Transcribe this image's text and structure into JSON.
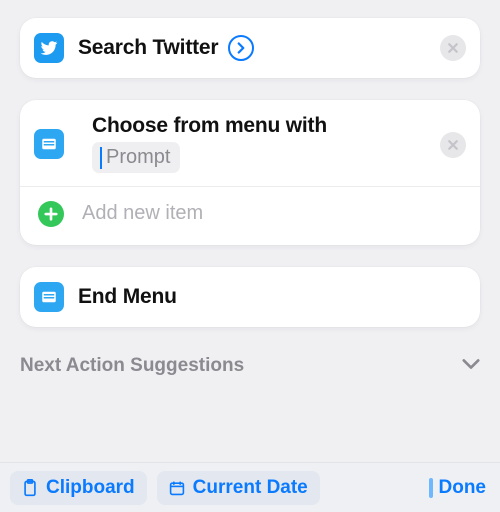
{
  "actions": {
    "search_twitter": {
      "title": "Search Twitter"
    },
    "choose_menu": {
      "title": "Choose from menu with",
      "prompt_token": "Prompt",
      "add_item_label": "Add new item"
    },
    "end_menu": {
      "title": "End Menu"
    }
  },
  "suggestions": {
    "header": "Next Action Suggestions",
    "chips": {
      "clipboard": "Clipboard",
      "current_date": "Current Date"
    }
  },
  "keyboard": {
    "done": "Done"
  }
}
